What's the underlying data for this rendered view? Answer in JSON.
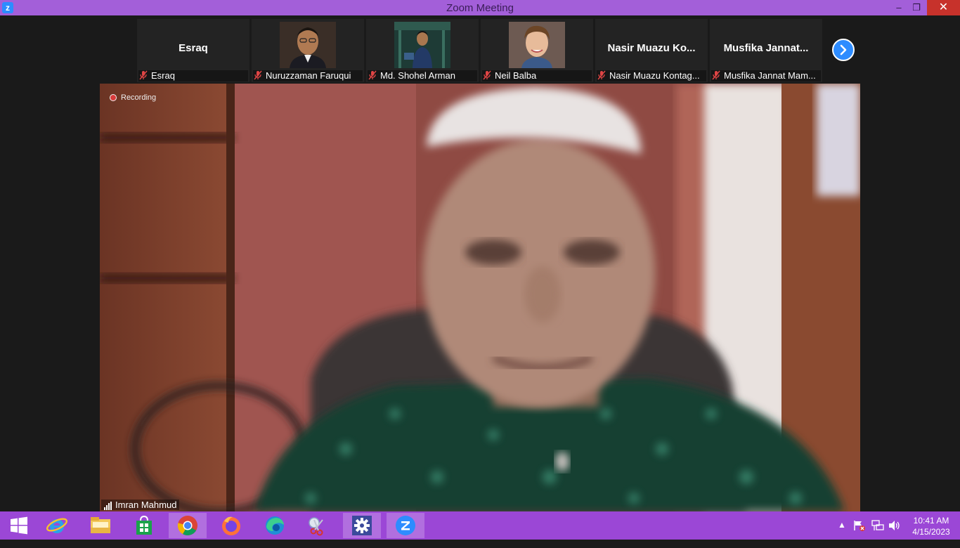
{
  "window": {
    "title": "Zoom Meeting",
    "minimize": "–",
    "maximize": "❐",
    "close": "✕"
  },
  "participants": [
    {
      "display": "Esraq",
      "label": "Esraq",
      "muted": true,
      "video": false
    },
    {
      "display": "",
      "label": "Nuruzzaman Faruqui",
      "muted": true,
      "video": true
    },
    {
      "display": "",
      "label": "Md. Shohel Arman",
      "muted": true,
      "video": true
    },
    {
      "display": "",
      "label": "Neil Balba",
      "muted": true,
      "video": true
    },
    {
      "display": "Nasir Muazu Ko...",
      "label": "Nasir Muazu Kontag...",
      "muted": true,
      "video": false
    },
    {
      "display": "Musfika Jannat...",
      "label": "Musfika Jannat Mam...",
      "muted": true,
      "video": false
    }
  ],
  "main_video": {
    "recording_label": "Recording",
    "speaker_name": "Imran Mahmud"
  },
  "taskbar": {
    "time": "10:41 AM",
    "date": "4/15/2023",
    "tray_chevron": "▲"
  },
  "colors": {
    "title_bar": "#a35fd9",
    "taskbar": "#9b47d6",
    "zoom_blue": "#2d8cff",
    "recording_red": "#d93b3b"
  }
}
